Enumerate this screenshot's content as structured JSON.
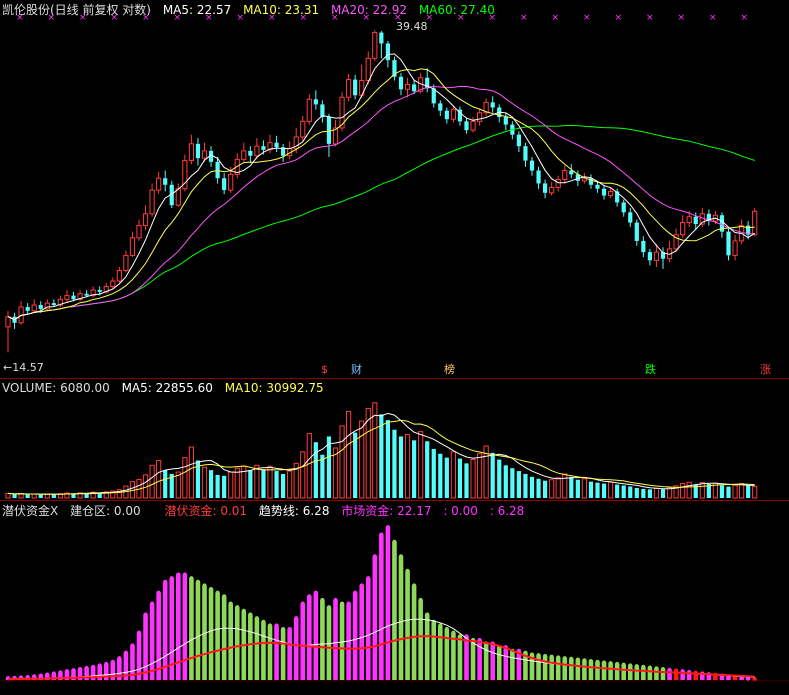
{
  "colors": {
    "up": "#ff3c3c",
    "down": "#54fcfc",
    "ma5": "#ffffff",
    "ma10": "#ffff55",
    "ma20": "#ff55ff",
    "ma60": "#00ff00",
    "magenta_bar": "#ff33ff",
    "green_bar": "#8ed85a",
    "red_bar": "#ff1a1a"
  },
  "header": {
    "title": "凯伦股份(日线 前复权 对数)",
    "ma5_label": "MA5: 22.57",
    "ma10_label": "MA10: 23.31",
    "ma20_label": "MA20: 22.92",
    "ma60_label": "MA60: 27.40"
  },
  "price_panel": {
    "high_label": "39.48",
    "low_label": "←14.57",
    "events": [
      {
        "name": "dollar",
        "text": "$",
        "color": "#ff3c3c"
      },
      {
        "name": "cai",
        "text": "财",
        "color": "#7fbfff"
      },
      {
        "name": "bang",
        "text": "榜",
        "color": "#ffcc66"
      },
      {
        "name": "die",
        "text": "跌",
        "color": "#00ff00"
      },
      {
        "name": "zhang",
        "text": "涨",
        "color": "#ff3c3c"
      }
    ]
  },
  "volume_panel": {
    "volume_label": "VOLUME: 6080.00",
    "ma5_label": "MA5: 22855.60",
    "ma10_label": "MA10: 30992.75"
  },
  "indicator_panel": {
    "name": "潜伏资金X",
    "build_label": "建仓区: 0.00",
    "latent_label": "潜伏资金: 0.01",
    "trend_label": "趋势线: 6.28",
    "market_label": "市场资金: 22.17",
    "extra1": ": 0.00",
    "extra2": ": 6.28"
  },
  "chart_data": {
    "type": "candlestick",
    "title": "凯伦股份(日线 前复权 对数)",
    "log_scale": true,
    "marked_high": 39.48,
    "marked_low": 14.57,
    "candles": [
      [
        15.8,
        16.3,
        16.6,
        14.6
      ],
      [
        16.3,
        16.0,
        16.5,
        15.7
      ],
      [
        16.0,
        16.8,
        17.1,
        15.9
      ],
      [
        16.8,
        16.6,
        17.0,
        16.4
      ],
      [
        16.6,
        16.9,
        17.2,
        16.5
      ],
      [
        16.9,
        16.7,
        17.1,
        16.5
      ],
      [
        16.7,
        17.0,
        17.2,
        16.6
      ],
      [
        17.0,
        16.9,
        17.2,
        16.8
      ],
      [
        16.9,
        17.2,
        17.4,
        16.8
      ],
      [
        17.2,
        17.4,
        17.7,
        17.0
      ],
      [
        17.4,
        17.2,
        17.6,
        17.1
      ],
      [
        17.2,
        17.5,
        17.7,
        17.1
      ],
      [
        17.5,
        17.4,
        17.7,
        17.3
      ],
      [
        17.4,
        17.7,
        17.9,
        17.3
      ],
      [
        17.7,
        17.6,
        17.9,
        17.4
      ],
      [
        17.6,
        17.9,
        18.1,
        17.5
      ],
      [
        17.9,
        18.2,
        18.4,
        17.8
      ],
      [
        18.2,
        18.8,
        19.0,
        18.1
      ],
      [
        18.8,
        19.7,
        20.0,
        18.7
      ],
      [
        19.7,
        20.8,
        21.2,
        19.6
      ],
      [
        20.8,
        21.6,
        22.0,
        20.6
      ],
      [
        21.6,
        22.4,
        23.0,
        21.3
      ],
      [
        22.4,
        24.1,
        24.6,
        22.2
      ],
      [
        24.1,
        25.0,
        25.5,
        23.8
      ],
      [
        25.0,
        24.5,
        25.6,
        24.0
      ],
      [
        24.5,
        23.0,
        24.8,
        22.8
      ],
      [
        23.0,
        24.2,
        24.6,
        22.9
      ],
      [
        24.2,
        26.4,
        26.9,
        24.0
      ],
      [
        26.4,
        27.8,
        28.6,
        26.1
      ],
      [
        27.8,
        26.6,
        28.3,
        26.0
      ],
      [
        26.6,
        27.2,
        27.9,
        26.3
      ],
      [
        27.2,
        26.3,
        27.6,
        25.9
      ],
      [
        26.3,
        25.0,
        26.7,
        24.6
      ],
      [
        25.0,
        24.1,
        25.4,
        23.8
      ],
      [
        24.1,
        25.3,
        25.9,
        23.9
      ],
      [
        25.3,
        26.5,
        27.0,
        25.0
      ],
      [
        26.5,
        27.2,
        27.9,
        26.3
      ],
      [
        27.2,
        26.8,
        27.6,
        26.2
      ],
      [
        26.8,
        27.6,
        28.3,
        26.5
      ],
      [
        27.6,
        27.3,
        28.1,
        26.9
      ],
      [
        27.3,
        27.9,
        28.6,
        27.0
      ],
      [
        27.9,
        27.5,
        28.5,
        27.1
      ],
      [
        27.5,
        26.8,
        27.8,
        26.3
      ],
      [
        26.8,
        27.4,
        28.0,
        26.5
      ],
      [
        27.4,
        28.4,
        29.2,
        27.0
      ],
      [
        28.4,
        29.8,
        30.3,
        28.0
      ],
      [
        29.8,
        31.9,
        32.4,
        29.5
      ],
      [
        31.9,
        31.4,
        32.8,
        30.9
      ],
      [
        31.4,
        30.2,
        31.8,
        29.7
      ],
      [
        30.2,
        27.8,
        30.5,
        26.7
      ],
      [
        27.8,
        29.2,
        29.9,
        27.6
      ],
      [
        29.2,
        32.1,
        32.6,
        28.9
      ],
      [
        32.1,
        33.9,
        34.5,
        31.7
      ],
      [
        33.9,
        32.3,
        34.4,
        31.9
      ],
      [
        32.3,
        33.8,
        35.5,
        32.0
      ],
      [
        33.8,
        36.2,
        37.0,
        33.4
      ],
      [
        36.2,
        39.2,
        39.48,
        35.9
      ],
      [
        39.2,
        37.9,
        39.4,
        36.2
      ],
      [
        37.9,
        36.0,
        38.2,
        35.2
      ],
      [
        36.0,
        34.2,
        36.4,
        33.8
      ],
      [
        34.2,
        32.9,
        34.6,
        32.3
      ],
      [
        32.9,
        33.4,
        34.1,
        32.1
      ],
      [
        33.4,
        32.7,
        33.9,
        32.4
      ],
      [
        32.7,
        34.1,
        34.6,
        32.5
      ],
      [
        34.1,
        33.0,
        35.1,
        32.6
      ],
      [
        33.0,
        31.5,
        33.4,
        31.1
      ],
      [
        31.5,
        30.8,
        31.8,
        30.3
      ],
      [
        30.8,
        30.0,
        31.1,
        29.6
      ],
      [
        30.0,
        30.9,
        31.3,
        29.7
      ],
      [
        30.9,
        29.8,
        31.2,
        29.4
      ],
      [
        29.8,
        29.0,
        30.1,
        28.7
      ],
      [
        29.0,
        29.8,
        30.2,
        28.8
      ],
      [
        29.8,
        30.6,
        31.0,
        29.4
      ],
      [
        30.6,
        31.6,
        32.0,
        30.3
      ],
      [
        31.6,
        31.1,
        32.2,
        30.6
      ],
      [
        31.1,
        30.2,
        31.4,
        29.7
      ],
      [
        30.2,
        29.5,
        30.6,
        29.0
      ],
      [
        29.5,
        28.6,
        29.8,
        28.2
      ],
      [
        28.6,
        27.6,
        28.9,
        27.1
      ],
      [
        27.6,
        26.4,
        27.9,
        25.9
      ],
      [
        26.4,
        25.6,
        26.7,
        25.2
      ],
      [
        25.6,
        24.6,
        25.9,
        24.2
      ],
      [
        24.6,
        23.9,
        24.9,
        23.5
      ],
      [
        23.9,
        24.3,
        24.7,
        23.7
      ],
      [
        24.3,
        24.9,
        25.2,
        24.0
      ],
      [
        24.9,
        25.6,
        26.0,
        24.6
      ],
      [
        25.6,
        25.3,
        26.1,
        25.0
      ],
      [
        25.3,
        24.8,
        25.6,
        24.4
      ],
      [
        24.8,
        25.0,
        25.4,
        24.6
      ],
      [
        25.0,
        24.5,
        25.3,
        24.2
      ],
      [
        24.5,
        24.2,
        24.8,
        23.9
      ],
      [
        24.2,
        23.7,
        24.5,
        23.4
      ],
      [
        23.7,
        24.0,
        24.3,
        23.5
      ],
      [
        24.0,
        23.2,
        24.2,
        22.9
      ],
      [
        23.2,
        22.5,
        23.4,
        22.2
      ],
      [
        22.5,
        21.8,
        22.8,
        21.5
      ],
      [
        21.8,
        20.6,
        22.0,
        20.3
      ],
      [
        20.6,
        19.9,
        20.9,
        19.6
      ],
      [
        19.9,
        19.4,
        20.1,
        19.1
      ],
      [
        19.4,
        19.9,
        20.4,
        19.0
      ],
      [
        19.9,
        19.5,
        20.2,
        18.9
      ],
      [
        19.5,
        20.1,
        20.6,
        19.3
      ],
      [
        20.1,
        21.0,
        21.4,
        19.9
      ],
      [
        21.0,
        21.8,
        22.3,
        20.8
      ],
      [
        21.8,
        22.2,
        22.6,
        21.5
      ],
      [
        22.2,
        21.7,
        22.5,
        21.3
      ],
      [
        21.7,
        22.4,
        22.8,
        21.5
      ],
      [
        22.4,
        21.9,
        22.7,
        21.6
      ],
      [
        21.9,
        22.3,
        22.6,
        21.7
      ],
      [
        22.3,
        21.2,
        22.5,
        20.8
      ],
      [
        21.2,
        19.7,
        21.4,
        19.4
      ],
      [
        19.7,
        20.6,
        21.0,
        19.4
      ],
      [
        20.6,
        21.6,
        22.0,
        20.4
      ],
      [
        21.6,
        21.0,
        21.9,
        20.7
      ],
      [
        21.0,
        22.57,
        22.8,
        20.9
      ]
    ],
    "volume": [
      2400,
      1900,
      2300,
      1800,
      2100,
      1700,
      2000,
      1900,
      2200,
      2600,
      2400,
      2700,
      2500,
      3000,
      2800,
      3200,
      3600,
      4300,
      6200,
      8500,
      9600,
      12000,
      17000,
      19500,
      14500,
      12500,
      13500,
      21000,
      26500,
      19500,
      16000,
      14500,
      12000,
      11500,
      13500,
      15500,
      16500,
      14500,
      17000,
      15000,
      16500,
      14000,
      12500,
      14000,
      18000,
      24000,
      33500,
      29000,
      22500,
      32000,
      26000,
      37500,
      45000,
      34000,
      40000,
      46500,
      49500,
      43500,
      40500,
      35500,
      32000,
      33000,
      30000,
      34500,
      29500,
      25500,
      23000,
      21000,
      24000,
      20500,
      18000,
      20000,
      23000,
      27000,
      23500,
      20000,
      17000,
      15500,
      14000,
      12500,
      11000,
      10000,
      9000,
      9500,
      10500,
      12500,
      11000,
      9500,
      10000,
      8500,
      8000,
      7500,
      8200,
      7000,
      6500,
      6000,
      5200,
      4700,
      4500,
      5000,
      4600,
      5400,
      6300,
      7600,
      8200,
      7100,
      8000,
      7300,
      7800,
      6600,
      5900,
      6700,
      7500,
      6700,
      6080
    ],
    "indicator": [
      0.5,
      0.6,
      0.7,
      0.8,
      1.0,
      1.2,
      1.5,
      1.8,
      2.1,
      2.4,
      2.7,
      3.0,
      3.3,
      3.6,
      4.0,
      4.4,
      5.0,
      6.0,
      7.5,
      9.5,
      13,
      18,
      21,
      24,
      27,
      28,
      29,
      29,
      28,
      27,
      26,
      25,
      24,
      23,
      21,
      20,
      19,
      18,
      17,
      16,
      15,
      15,
      14,
      14,
      17,
      21,
      23,
      24,
      22,
      20,
      22,
      21,
      21,
      24,
      26,
      28,
      34,
      40,
      42,
      38,
      34,
      30,
      26,
      22,
      18,
      16,
      15,
      14,
      13,
      12,
      12,
      11,
      11,
      10,
      10,
      9,
      9,
      8,
      8,
      7.5,
      7,
      6.8,
      6.6,
      6.4,
      6.2,
      6,
      5.8,
      5.6,
      5.4,
      5.2,
      5,
      4.8,
      4.6,
      4.4,
      4.2,
      4,
      3.8,
      3.6,
      3.4,
      3.2,
      3.0,
      2.8,
      2.6,
      2.4,
      2.2,
      2.0,
      1.8,
      1.6,
      1.4,
      1.2,
      1.0,
      0.8,
      0.6,
      0.4,
      0.2
    ]
  }
}
